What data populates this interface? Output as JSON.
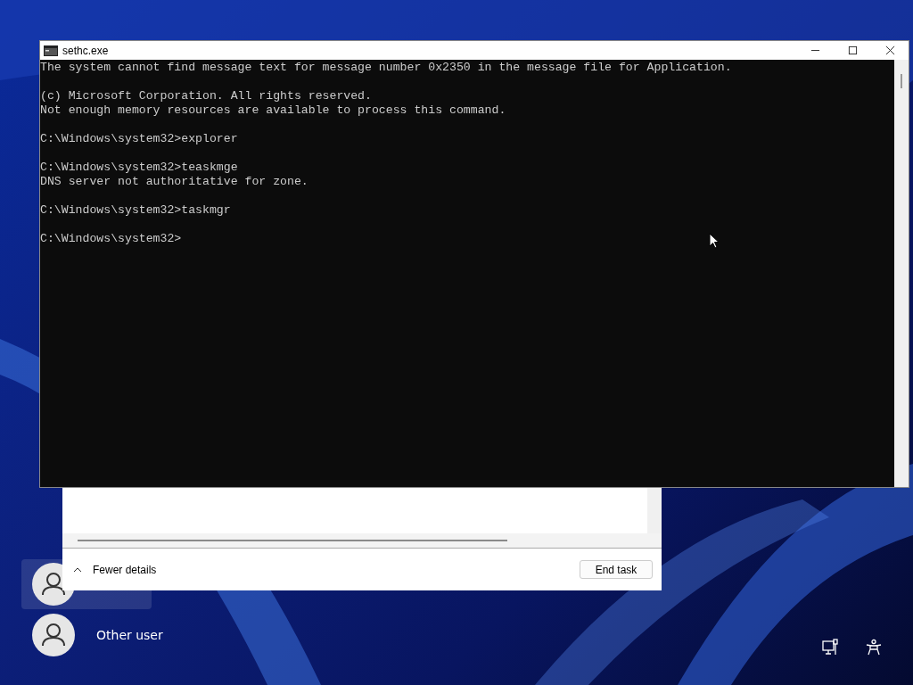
{
  "console_window": {
    "title": "sethc.exe",
    "output_blocks": [
      [
        "The system cannot find message text for message number 0x2350 in the message file for Application."
      ],
      [
        "(c) Microsoft Corporation. All rights reserved.",
        "Not enough memory resources are available to process this command."
      ],
      [
        "C:\\Windows\\system32>explorer"
      ],
      [
        "C:\\Windows\\system32>teaskmge",
        "DNS server not authoritative for zone."
      ],
      [
        "C:\\Windows\\system32>taskmgr"
      ],
      [
        "C:\\Windows\\system32>"
      ]
    ]
  },
  "task_manager": {
    "details_toggle": "Fewer details",
    "end_task_button": "End task"
  },
  "lock_screen": {
    "users": [
      {
        "selected": true
      },
      {
        "name": "Other user",
        "selected": false
      }
    ]
  }
}
